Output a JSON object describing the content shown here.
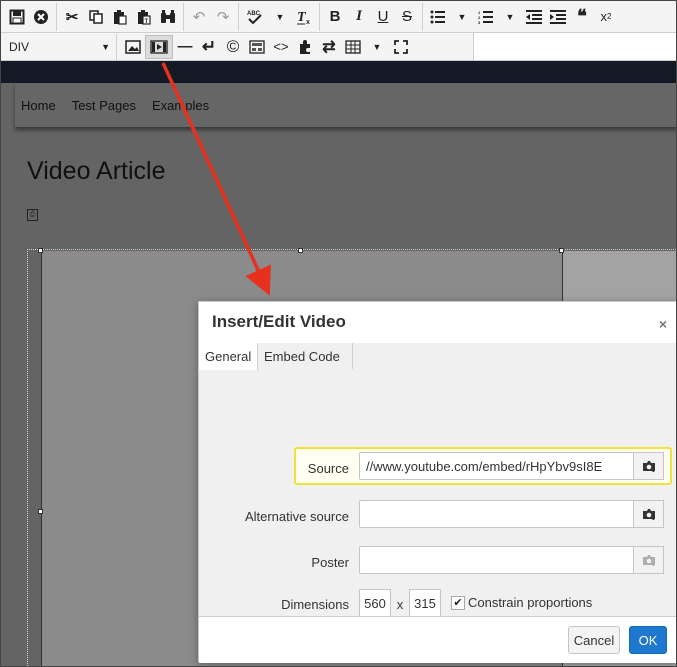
{
  "toolbar": {
    "row1": [
      {
        "icon": "save-icon",
        "glyph": "💾"
      },
      {
        "icon": "cancel-icon",
        "glyph": "⊗"
      },
      {
        "icon": "cut-icon",
        "glyph": "✂"
      },
      {
        "icon": "copy-icon",
        "glyph": "⎘"
      },
      {
        "icon": "paste-icon",
        "glyph": "📋"
      },
      {
        "icon": "paste-text-icon",
        "glyph": "📋"
      },
      {
        "icon": "find-icon",
        "glyph": "🔭"
      },
      {
        "icon": "undo-icon",
        "glyph": "↶"
      },
      {
        "icon": "redo-icon",
        "glyph": "↷"
      },
      {
        "icon": "spellcheck-icon",
        "glyph": "ᴬᴮᶜ✓"
      },
      {
        "icon": "remove-format-icon",
        "glyph": "T̸ₓ"
      },
      {
        "icon": "bold-icon",
        "glyph": "B"
      },
      {
        "icon": "italic-icon",
        "glyph": "I"
      },
      {
        "icon": "underline-icon",
        "glyph": "U"
      },
      {
        "icon": "strikethrough-icon",
        "glyph": "S"
      },
      {
        "icon": "bullet-list-icon",
        "glyph": "☰"
      },
      {
        "icon": "numbered-list-icon",
        "glyph": "☰"
      },
      {
        "icon": "outdent-icon",
        "glyph": "⇤"
      },
      {
        "icon": "indent-icon",
        "glyph": "⇥"
      },
      {
        "icon": "blockquote-icon",
        "glyph": "❝"
      },
      {
        "icon": "superscript-icon",
        "glyph": "x²"
      }
    ],
    "format_value": "DIV",
    "row2": [
      {
        "icon": "image-icon",
        "glyph": "▣"
      },
      {
        "icon": "media-icon",
        "glyph": "🎞"
      },
      {
        "icon": "horizontal-rule-icon",
        "glyph": "—"
      },
      {
        "icon": "line-break-icon",
        "glyph": "↵"
      },
      {
        "icon": "copyright-icon",
        "glyph": "©"
      },
      {
        "icon": "template-icon",
        "glyph": "▦"
      },
      {
        "icon": "code-icon",
        "glyph": "‹›"
      },
      {
        "icon": "plugin-icon",
        "glyph": "✚"
      },
      {
        "icon": "swap-icon",
        "glyph": "⇄"
      },
      {
        "icon": "table-icon",
        "glyph": "⊞"
      },
      {
        "icon": "fullscreen-icon",
        "glyph": "⤢"
      }
    ]
  },
  "page": {
    "nav": [
      "Home",
      "Test Pages",
      "Examples"
    ],
    "title": "Video Article"
  },
  "dialog": {
    "title": "Insert/Edit Video",
    "close": "×",
    "tabs": [
      "General",
      "Embed Code"
    ],
    "fields": {
      "source_label": "Source",
      "source_value": "//www.youtube.com/embed/rHpYbv9sI8E",
      "alt_source_label": "Alternative source",
      "alt_source_value": "",
      "poster_label": "Poster",
      "poster_value": "",
      "dimensions_label": "Dimensions",
      "width": "560",
      "separator": "x",
      "height": "315",
      "constrain_checked": true,
      "constrain_label": "Constrain proportions"
    },
    "cancel": "Cancel",
    "ok": "OK"
  },
  "colors": {
    "highlight": "#f2e13a",
    "ok_button": "#1e78d0",
    "arrow": "#e8301e"
  }
}
